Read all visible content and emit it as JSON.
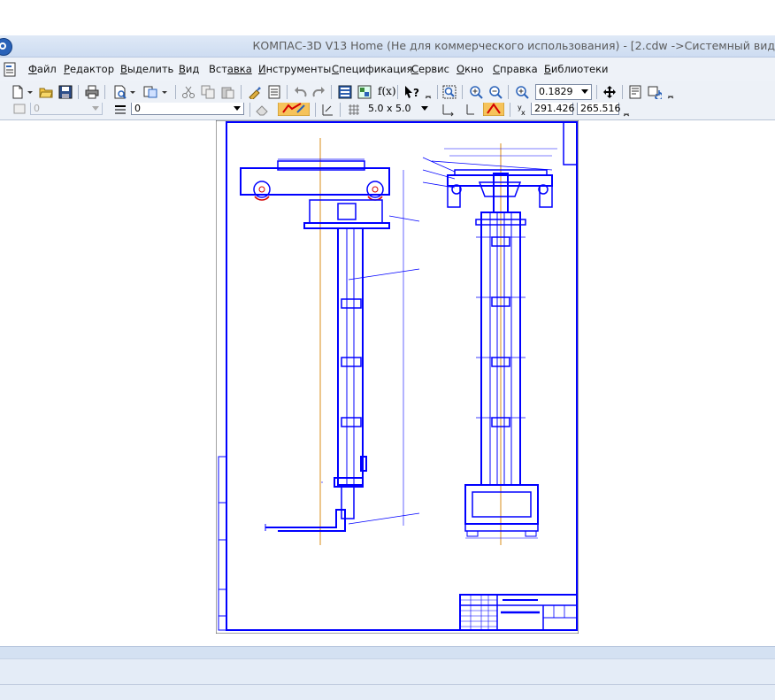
{
  "window": {
    "title": "КОМПАС-3D V13 Home (Не для коммерческого использования) - [2.cdw ->Системный вид"
  },
  "menu": {
    "items": [
      {
        "hot": "Ф",
        "rest": "айл"
      },
      {
        "hot": "Р",
        "rest": "едактор"
      },
      {
        "hot": "В",
        "rest": "ыделить"
      },
      {
        "hot": "В",
        "rest": "ид"
      },
      {
        "hot": "Вст",
        "rest": "авка"
      },
      {
        "hot": "И",
        "rest": "нструменты"
      },
      {
        "hot": "С",
        "rest": "пецификация"
      },
      {
        "hot": "С",
        "rest": "ервис"
      },
      {
        "hot": "О",
        "rest": "кно"
      },
      {
        "hot": "С",
        "rest": "правка"
      },
      {
        "hot": "Б",
        "rest": "иблиотеки"
      }
    ]
  },
  "toolbar": {
    "zoom_value": "0.1829",
    "fx_label": "f(x)",
    "layer_value": "0",
    "style_value": "0",
    "grid_value": "5.0 x 5.0",
    "coord_x": "291.426",
    "coord_y": "265.516"
  },
  "colors": {
    "drawing_line": "#0000ff",
    "axis_line": "#d98c1a",
    "accent_red": "#d40000"
  }
}
